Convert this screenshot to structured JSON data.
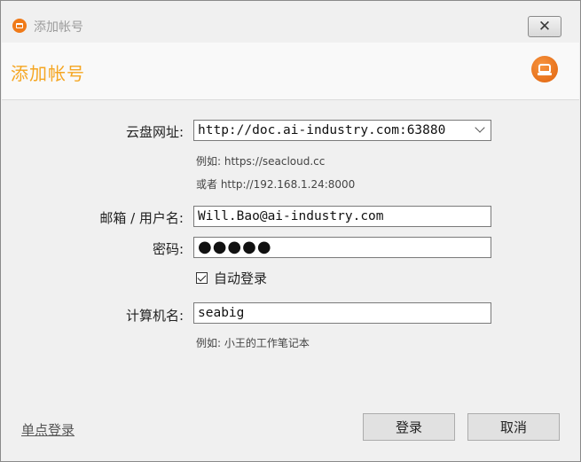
{
  "window": {
    "title": "添加帐号",
    "close_icon": "✕"
  },
  "header": {
    "title": "添加帐号",
    "logo_icon": "seafile-logo-icon",
    "accent_color": "#f5a623"
  },
  "form": {
    "server_label": "云盘网址:",
    "server_value": "http://doc.ai-industry.com:63880",
    "server_hint_1": "例如:   https://seacloud.cc",
    "server_hint_2": "或者 http://192.168.1.24:8000",
    "email_label": "邮箱 / 用户名:",
    "email_value": "Will.Bao@ai-industry.com",
    "password_label": "密码:",
    "password_value": "●●●●●",
    "auto_login_label": "自动登录",
    "auto_login_checked": true,
    "computer_label": "计算机名:",
    "computer_value": "seabig",
    "computer_hint": "例如: 小王的工作笔记本"
  },
  "footer": {
    "sso_label": "单点登录",
    "login_label": "登录",
    "cancel_label": "取消"
  }
}
